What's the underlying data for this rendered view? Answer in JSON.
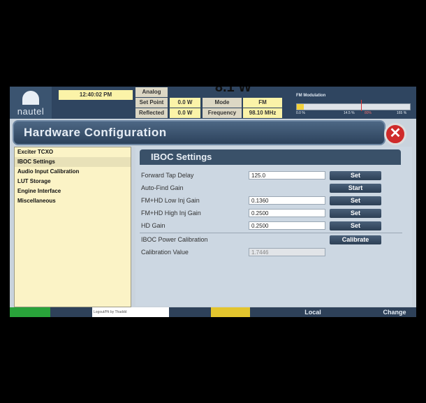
{
  "header": {
    "logo_text": "nautel",
    "time": "12:40:02 PM",
    "meter": {
      "analog_label": "Analog",
      "set_point_label": "Set Point",
      "set_point_value": "0.0 W",
      "reflected_label": "Reflected",
      "reflected_value": "0.0 W",
      "mode_label": "Mode",
      "mode_value": "FM",
      "frequency_label": "Frequency",
      "frequency_value": "98.10 MHz",
      "big_power": "8.1 W"
    },
    "fm_modulation": {
      "title": "FM Modulation",
      "tick_left": "0.0 %",
      "tick_mid": "14.5 %",
      "tick_red": "80%",
      "tick_right": "165 %",
      "level_fraction": 0.06
    }
  },
  "window": {
    "title": "Hardware Configuration",
    "close_symbol": "✕"
  },
  "sidebar": {
    "items": [
      {
        "label": "Exciter TCXO"
      },
      {
        "label": "IBOC Settings",
        "selected": true
      },
      {
        "label": "Audio Input Calibration"
      },
      {
        "label": "LUT Storage"
      },
      {
        "label": "Engine Interface"
      },
      {
        "label": "Miscellaneous"
      }
    ]
  },
  "iboc": {
    "heading": "IBOC Settings",
    "rows": {
      "forward_tap_delay": {
        "label": "Forward Tap Delay",
        "value": "125.0",
        "button": "Set"
      },
      "auto_find_gain": {
        "label": "Auto-Find Gain",
        "button": "Start"
      },
      "fm_hd_low": {
        "label": "FM+HD Low Inj Gain",
        "value": "0.1360",
        "button": "Set"
      },
      "fm_hd_high": {
        "label": "FM+HD High Inj Gain",
        "value": "0.2500",
        "button": "Set"
      },
      "hd_gain": {
        "label": "HD Gain",
        "value": "0.2500",
        "button": "Set"
      },
      "power_cal": {
        "label": "IBOC Power Calibration",
        "button": "Calibrate"
      },
      "cal_value": {
        "label": "Calibration Value",
        "value": "1.7446"
      }
    }
  },
  "bottom": {
    "ticker": "Logout/Pit by Thaddd",
    "local": "Local",
    "change": "Change",
    "colors": {
      "green": "#29a33a",
      "yellow": "#e3c52e"
    }
  }
}
